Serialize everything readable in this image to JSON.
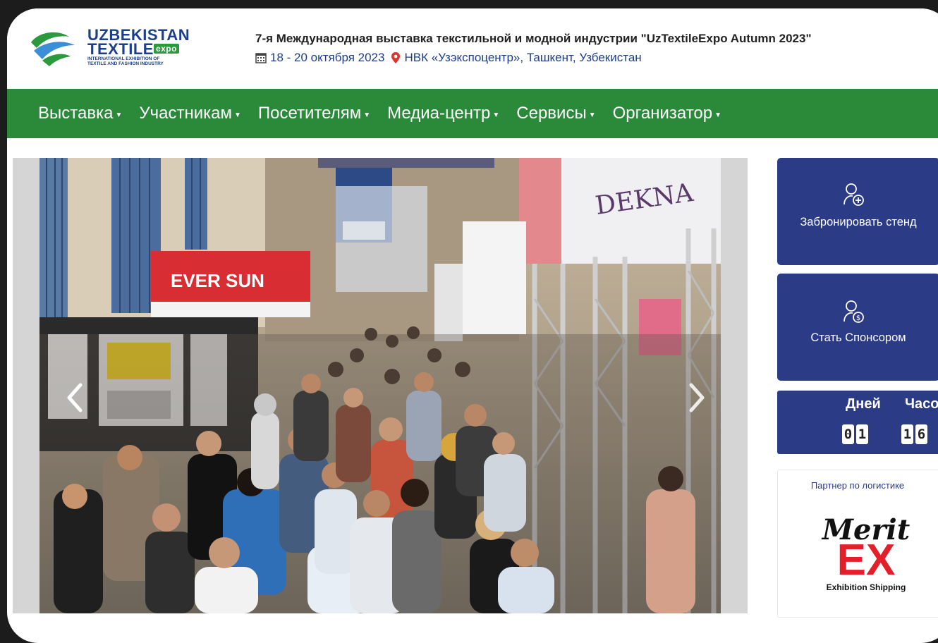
{
  "header": {
    "logo": {
      "line1": "UZBEKISTAN",
      "line2": "TEXTILE",
      "badge": "expo",
      "subtitle": "INTERNATIONAL EXHIBITION OF TEXTILE AND FASHION INDUSTRY"
    },
    "event_title": "7-я Международная выставка текстильной и модной индустрии \"UzTextileExpo Autumn 2023\"",
    "event_dates": "18 - 20 октября 2023",
    "event_venue": "НВК «Узэкспоцентр», Ташкент, Узбекистан"
  },
  "nav": {
    "items": [
      {
        "label": "Выставка"
      },
      {
        "label": "Участникам"
      },
      {
        "label": "Посетителям"
      },
      {
        "label": "Медиа-центр"
      },
      {
        "label": "Сервисы"
      },
      {
        "label": "Организатор"
      }
    ]
  },
  "sidebar": {
    "book_stand": "Забронировать стенд",
    "become_sponsor": "Стать Спонсором",
    "countdown": {
      "days_label": "Дней",
      "hours_label": "Часов",
      "days": "01",
      "hours": "16"
    },
    "partner": {
      "title": "Партнер по логистике",
      "logo_word": "Merit",
      "logo_ex": "EX",
      "logo_tagline": "Exhibition Shipping"
    }
  },
  "slider": {
    "banner_text": "EVER SUN",
    "booth_sign": "DEKNA"
  },
  "colors": {
    "nav_green": "#2a8a3a",
    "brand_blue": "#2b3b86",
    "logo_blue": "#1d3f8a",
    "merit_red": "#e3202a"
  }
}
